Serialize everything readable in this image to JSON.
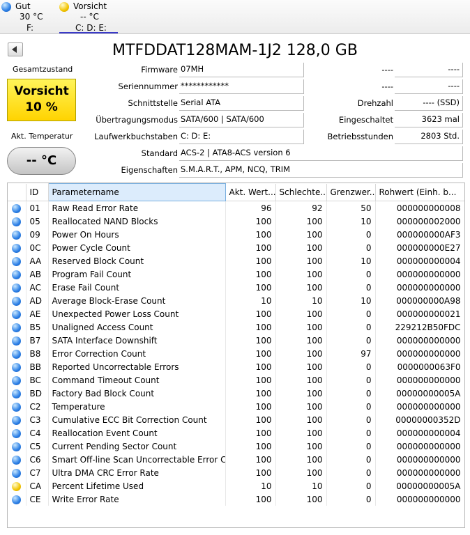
{
  "drives": [
    {
      "status": "Gut",
      "temp": "30 °C",
      "letters": "F:"
    },
    {
      "status": "Vorsicht",
      "temp": "-- °C",
      "letters": "C: D: E:"
    }
  ],
  "model": "MTFDDAT128MAM-1J2 128,0 GB",
  "health": {
    "label": "Gesamtzustand",
    "status": "Vorsicht",
    "percent": "10 %",
    "color": "#ffd300"
  },
  "temperature": {
    "label": "Akt. Temperatur",
    "value": "-- °C"
  },
  "info": {
    "firmware": {
      "label": "Firmware",
      "value": "07MH"
    },
    "serial": {
      "label": "Seriennummer",
      "value": "************"
    },
    "interface": {
      "label": "Schnittstelle",
      "value": "Serial ATA"
    },
    "transfer": {
      "label": "Übertragungsmodus",
      "value": "SATA/600 | SATA/600"
    },
    "drive_letters": {
      "label": "Laufwerkbuchstaben",
      "value": "C: D: E:"
    },
    "standard": {
      "label": "Standard",
      "value": "ACS-2 | ATA8-ACS version 6"
    },
    "features": {
      "label": "Eigenschaften",
      "value": "S.M.A.R.T., APM, NCQ, TRIM"
    },
    "right1": {
      "label": "----",
      "value": "----"
    },
    "right2": {
      "label": "----",
      "value": "----"
    },
    "rotation": {
      "label": "Drehzahl",
      "value": "---- (SSD)"
    },
    "power_on_count": {
      "label": "Eingeschaltet",
      "value": "3623 mal"
    },
    "power_on_hours": {
      "label": "Betriebsstunden",
      "value": "2803 Std."
    }
  },
  "table": {
    "headers": [
      "",
      "ID",
      "Parametername",
      "Akt. Wert...",
      "Schlechte...",
      "Grenzwer...",
      "Rohwert (Einh. b..."
    ],
    "rows": [
      {
        "s": "good",
        "id": "01",
        "name": "Raw Read Error Rate",
        "cur": "96",
        "worst": "92",
        "thr": "50",
        "raw": "000000000008"
      },
      {
        "s": "good",
        "id": "05",
        "name": "Reallocated NAND Blocks",
        "cur": "100",
        "worst": "100",
        "thr": "10",
        "raw": "000000002000"
      },
      {
        "s": "good",
        "id": "09",
        "name": "Power On Hours",
        "cur": "100",
        "worst": "100",
        "thr": "0",
        "raw": "000000000AF3"
      },
      {
        "s": "good",
        "id": "0C",
        "name": "Power Cycle Count",
        "cur": "100",
        "worst": "100",
        "thr": "0",
        "raw": "000000000E27"
      },
      {
        "s": "good",
        "id": "AA",
        "name": "Reserved Block Count",
        "cur": "100",
        "worst": "100",
        "thr": "10",
        "raw": "000000000004"
      },
      {
        "s": "good",
        "id": "AB",
        "name": "Program Fail Count",
        "cur": "100",
        "worst": "100",
        "thr": "0",
        "raw": "000000000000"
      },
      {
        "s": "good",
        "id": "AC",
        "name": "Erase Fail Count",
        "cur": "100",
        "worst": "100",
        "thr": "0",
        "raw": "000000000000"
      },
      {
        "s": "good",
        "id": "AD",
        "name": "Average Block-Erase Count",
        "cur": "10",
        "worst": "10",
        "thr": "10",
        "raw": "000000000A98"
      },
      {
        "s": "good",
        "id": "AE",
        "name": "Unexpected Power Loss Count",
        "cur": "100",
        "worst": "100",
        "thr": "0",
        "raw": "000000000021"
      },
      {
        "s": "good",
        "id": "B5",
        "name": "Unaligned Access Count",
        "cur": "100",
        "worst": "100",
        "thr": "0",
        "raw": "229212B50FDC"
      },
      {
        "s": "good",
        "id": "B7",
        "name": "SATA Interface Downshift",
        "cur": "100",
        "worst": "100",
        "thr": "0",
        "raw": "000000000000"
      },
      {
        "s": "good",
        "id": "B8",
        "name": "Error Correction Count",
        "cur": "100",
        "worst": "100",
        "thr": "97",
        "raw": "000000000000"
      },
      {
        "s": "good",
        "id": "BB",
        "name": "Reported Uncorrectable Errors",
        "cur": "100",
        "worst": "100",
        "thr": "0",
        "raw": "0000000063F0"
      },
      {
        "s": "good",
        "id": "BC",
        "name": "Command Timeout Count",
        "cur": "100",
        "worst": "100",
        "thr": "0",
        "raw": "000000000000"
      },
      {
        "s": "good",
        "id": "BD",
        "name": "Factory Bad Block Count",
        "cur": "100",
        "worst": "100",
        "thr": "0",
        "raw": "00000000005A"
      },
      {
        "s": "good",
        "id": "C2",
        "name": "Temperature",
        "cur": "100",
        "worst": "100",
        "thr": "0",
        "raw": "000000000000"
      },
      {
        "s": "good",
        "id": "C3",
        "name": "Cumulative ECC Bit Correction Count",
        "cur": "100",
        "worst": "100",
        "thr": "0",
        "raw": "00000000352D"
      },
      {
        "s": "good",
        "id": "C4",
        "name": "Reallocation Event Count",
        "cur": "100",
        "worst": "100",
        "thr": "0",
        "raw": "000000000004"
      },
      {
        "s": "good",
        "id": "C5",
        "name": "Current Pending Sector Count",
        "cur": "100",
        "worst": "100",
        "thr": "0",
        "raw": "000000000000"
      },
      {
        "s": "good",
        "id": "C6",
        "name": "Smart Off-line Scan Uncorrectable Error Count",
        "cur": "100",
        "worst": "100",
        "thr": "0",
        "raw": "000000000000"
      },
      {
        "s": "good",
        "id": "C7",
        "name": "Ultra DMA CRC Error Rate",
        "cur": "100",
        "worst": "100",
        "thr": "0",
        "raw": "000000000000"
      },
      {
        "s": "warn",
        "id": "CA",
        "name": "Percent Lifetime Used",
        "cur": "10",
        "worst": "10",
        "thr": "0",
        "raw": "00000000005A"
      },
      {
        "s": "good",
        "id": "CE",
        "name": "Write Error Rate",
        "cur": "100",
        "worst": "100",
        "thr": "0",
        "raw": "000000000000"
      }
    ]
  }
}
